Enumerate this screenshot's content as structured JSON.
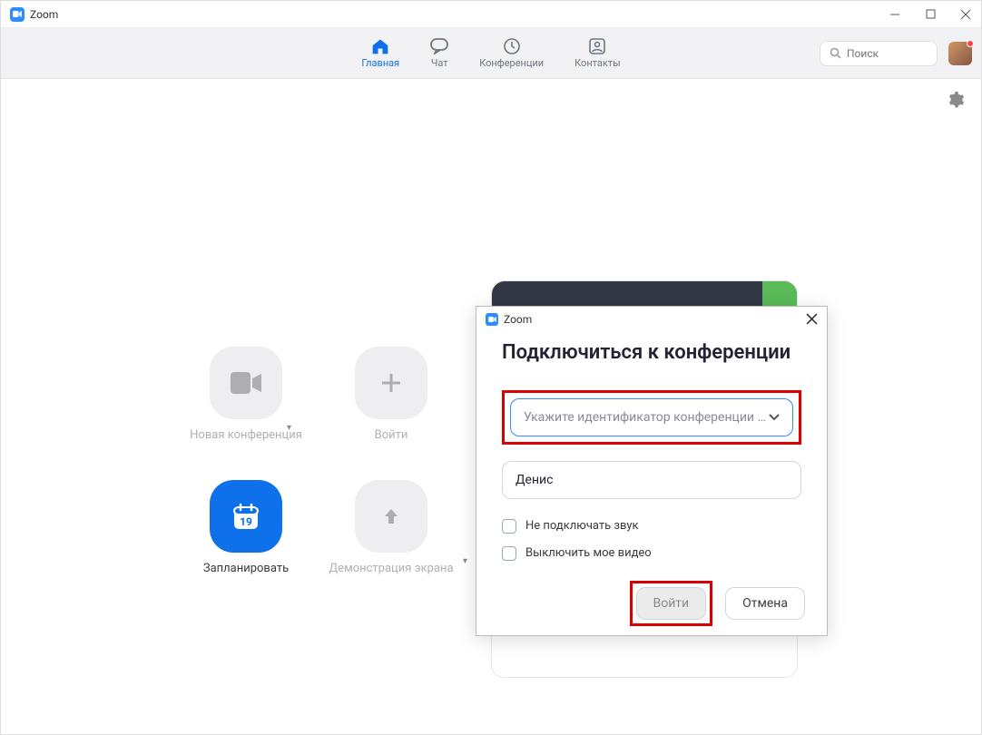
{
  "app": {
    "title": "Zoom"
  },
  "nav": {
    "tabs": [
      {
        "label": "Главная",
        "active": true
      },
      {
        "label": "Чат",
        "active": false
      },
      {
        "label": "Конференции",
        "active": false
      },
      {
        "label": "Контакты",
        "active": false
      }
    ],
    "search_placeholder": "Поиск"
  },
  "actions": {
    "new_meeting": "Новая конференция",
    "join": "Войти",
    "schedule": "Запланировать",
    "schedule_day": "19",
    "share": "Демонстрация экрана"
  },
  "dialog": {
    "title": "Zoom",
    "heading": "Подключиться к конференции",
    "id_placeholder": "Укажите идентификатор конференции …",
    "name_value": "Денис",
    "checkbox_audio": "Не подключать звук",
    "checkbox_video": "Выключить мое видео",
    "btn_join": "Войти",
    "btn_cancel": "Отмена"
  }
}
